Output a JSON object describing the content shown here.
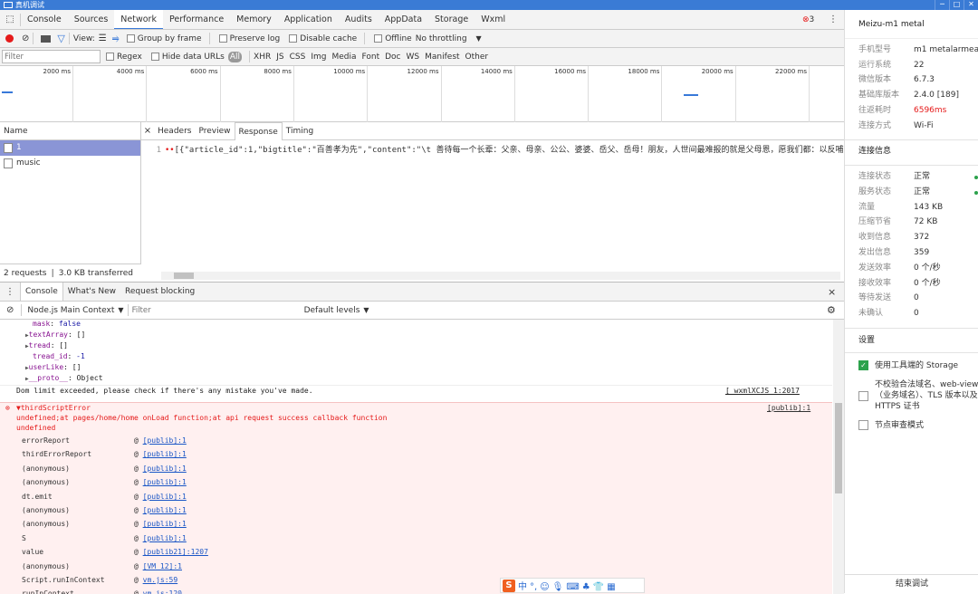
{
  "window": {
    "title": "真机调试",
    "buttons": [
      "─",
      "□",
      "✕"
    ]
  },
  "tabs": {
    "items": [
      "Console",
      "Sources",
      "Network",
      "Performance",
      "Memory",
      "Application",
      "Audits",
      "AppData",
      "Storage",
      "Wxml"
    ],
    "active": "Network",
    "error_count": "3"
  },
  "net_toolbar": {
    "view_label": "View:",
    "group_by_frame": "Group by frame",
    "preserve_log": "Preserve log",
    "disable_cache": "Disable cache",
    "offline": "Offline",
    "throttling": "No throttling"
  },
  "filter_bar": {
    "placeholder": "Filter",
    "regex": "Regex",
    "hide_data_urls": "Hide data URLs",
    "all": "All",
    "types": [
      "XHR",
      "JS",
      "CSS",
      "Img",
      "Media",
      "Font",
      "Doc",
      "WS",
      "Manifest",
      "Other"
    ]
  },
  "overview": {
    "ticks": [
      "2000 ms",
      "4000 ms",
      "6000 ms",
      "8000 ms",
      "10000 ms",
      "12000 ms",
      "14000 ms",
      "16000 ms",
      "18000 ms",
      "20000 ms",
      "22000 ms"
    ]
  },
  "requests": {
    "header": "Name",
    "items": [
      {
        "name": "1",
        "selected": true
      },
      {
        "name": "music",
        "selected": false
      }
    ],
    "footer": "2 requests ❘ 3.0 KB transferred"
  },
  "detail": {
    "tabs": [
      "Headers",
      "Preview",
      "Response",
      "Timing"
    ],
    "active": "Response",
    "line_no": "1",
    "response": "[{\"article_id\":1,\"bigtitle\":\"百善孝为先\",\"content\":\"\\t    善待每一个长辈：父亲、母亲、公公、婆婆、岳父、岳母！朋友，人世间最难报的就是父母恩，愿我们都：以反哺"
  },
  "drawer": {
    "tabs": [
      "Console",
      "What's New",
      "Request blocking"
    ],
    "active": "Console",
    "context": "Node.js Main Context",
    "filter_placeholder": "Filter",
    "levels": "Default levels"
  },
  "console": {
    "obj_lines": [
      {
        "key": "mask",
        "val": "false",
        "arrow": false
      },
      {
        "key": "textArray",
        "val": "[]",
        "arrow": true
      },
      {
        "key": "tread",
        "val": "[]",
        "arrow": true
      },
      {
        "key": "tread_id",
        "val": "-1",
        "arrow": false
      },
      {
        "key": "userLike",
        "val": "[]",
        "arrow": true
      },
      {
        "key": "__proto__",
        "val": "Object",
        "arrow": true
      }
    ],
    "dom_limit": "Dom limit exceeded, please check if there's any mistake you've made.",
    "dom_limit_src": "[ wxmlXCJS 1:2017",
    "error_title": "▼thirdScriptError",
    "error_src": "[publib]:1",
    "error_msg1": "undefined;at pages/home/home onLoad function;at api request success callback function",
    "error_msg2": "undefined",
    "frames": [
      {
        "fn": "errorReport",
        "loc": "[publib]:1"
      },
      {
        "fn": "thirdErrorReport",
        "loc": "[publib]:1"
      },
      {
        "fn": "(anonymous)",
        "loc": "[publib]:1"
      },
      {
        "fn": "(anonymous)",
        "loc": "[publib]:1"
      },
      {
        "fn": "dt.emit",
        "loc": "[publib]:1"
      },
      {
        "fn": "(anonymous)",
        "loc": "[publib]:1"
      },
      {
        "fn": "(anonymous)",
        "loc": "[publib]:1"
      },
      {
        "fn": "S",
        "loc": "[publib]:1"
      },
      {
        "fn": "value",
        "loc": "[publib21]:1207"
      },
      {
        "fn": "(anonymous)",
        "loc": "[VM 12]:1"
      },
      {
        "fn": "Script.runInContext",
        "loc": "vm.js:59"
      },
      {
        "fn": "runInContext",
        "loc": "vm.js:120"
      }
    ]
  },
  "ime": {
    "logo": "S",
    "glyphs": [
      "中",
      "°,",
      "☺",
      "🎙",
      "⌨",
      "♣",
      "👕",
      "▦"
    ]
  },
  "device": {
    "name": "Meizu-m1 metal",
    "info": [
      {
        "k": "手机型号",
        "v": "m1 metalarmeab."
      },
      {
        "k": "运行系统",
        "v": "22"
      },
      {
        "k": "微信版本",
        "v": "6.7.3"
      },
      {
        "k": "基础库版本",
        "v": "2.4.0 [189]"
      },
      {
        "k": "往返耗时",
        "v": "6596ms",
        "red": true
      },
      {
        "k": "连接方式",
        "v": "Wi-Fi"
      }
    ],
    "conn_title": "连接信息",
    "conn": [
      {
        "k": "连接状态",
        "v": "正常",
        "dot": true
      },
      {
        "k": "服务状态",
        "v": "正常",
        "dot": true
      },
      {
        "k": "流量",
        "v": "143 KB"
      },
      {
        "k": "压缩节省",
        "v": "72 KB"
      },
      {
        "k": "收到信息",
        "v": "372"
      },
      {
        "k": "发出信息",
        "v": "359"
      },
      {
        "k": "发送效率",
        "v": "0 个/秒"
      },
      {
        "k": "接收效率",
        "v": "0 个/秒"
      },
      {
        "k": "等待发送",
        "v": "0"
      },
      {
        "k": "未确认",
        "v": "0"
      }
    ],
    "settings_title": "设置",
    "settings": [
      {
        "label": "使用工具端的 Storage",
        "checked": true
      },
      {
        "label": "不校验合法域名、web-view（业务域名）、TLS 版本以及 HTTPS 证书",
        "checked": false
      },
      {
        "label": "节点审查模式",
        "checked": false
      }
    ],
    "end_button": "结束调试"
  },
  "colors": {
    "accent": "#3879d9",
    "error_red": "#e51a1a",
    "ok_green": "#2ca24c",
    "selected_row": "#8a95d6"
  }
}
